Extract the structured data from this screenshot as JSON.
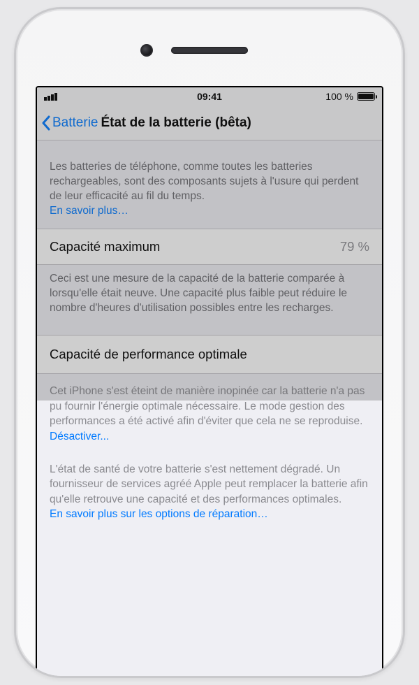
{
  "status_bar": {
    "time": "09:41",
    "battery_percent": "100 %"
  },
  "nav": {
    "back_label": "Batterie",
    "title": "État de la batterie (bêta)"
  },
  "intro": {
    "text": "Les batteries de téléphone, comme toutes les batteries rechargeables, sont des composants sujets à l'usure qui perdent de leur efficacité au fil du temps.",
    "learn_more": "En savoir plus…"
  },
  "capacity": {
    "label": "Capacité maximum",
    "value": "79 %",
    "footer": "Ceci est une mesure de la capacité de la batterie comparée à lorsqu'elle était neuve. Une capacité plus faible peut réduire le nombre d'heures d'utilisation possibles entre les recharges."
  },
  "performance": {
    "label": "Capacité de performance optimale",
    "shutdown_text": "Cet iPhone s'est éteint de manière inopinée car la batterie n'a pas pu fournir l'énergie optimale nécessaire. Le mode gestion des performances a été activé afin d'éviter que cela ne se reproduise. ",
    "disable_link": "Désactiver...",
    "degraded_text": "L'état de santé de votre batterie s'est nettement dégradé. Un fournisseur de services agréé Apple peut remplacer la batterie afin qu'elle retrouve une capacité et des performances optimales.",
    "repair_link": "En savoir plus sur les options de réparation…"
  }
}
